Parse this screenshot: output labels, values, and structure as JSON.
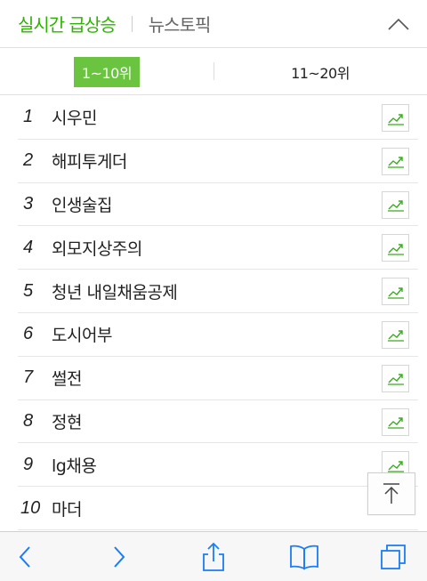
{
  "header": {
    "title_active": "실시간 급상승",
    "title_inactive": "뉴스토픽"
  },
  "range_tabs": [
    {
      "label": "1~10위",
      "active": true
    },
    {
      "label": "11~20위",
      "active": false
    }
  ],
  "items": [
    {
      "rank": "1",
      "keyword": "시우민"
    },
    {
      "rank": "2",
      "keyword": "해피투게더"
    },
    {
      "rank": "3",
      "keyword": "인생술집"
    },
    {
      "rank": "4",
      "keyword": "외모지상주의"
    },
    {
      "rank": "5",
      "keyword": "청년 내일채움공제"
    },
    {
      "rank": "6",
      "keyword": "도시어부"
    },
    {
      "rank": "7",
      "keyword": "썰전"
    },
    {
      "rank": "8",
      "keyword": "정현"
    },
    {
      "rank": "9",
      "keyword": "lg채용"
    },
    {
      "rank": "10",
      "keyword": "마더"
    }
  ],
  "colors": {
    "accent": "#2db400",
    "active_tab_bg": "#6ac43f",
    "toolbar_icon": "#1a7cf6"
  },
  "icons": {
    "collapse": "chevron-up-icon",
    "trend": "trend-chart-icon",
    "scroll_top": "arrow-up-to-top-icon",
    "toolbar": [
      "chevron-left-icon",
      "chevron-right-icon",
      "share-icon",
      "bookmarks-icon",
      "tabs-icon"
    ]
  }
}
